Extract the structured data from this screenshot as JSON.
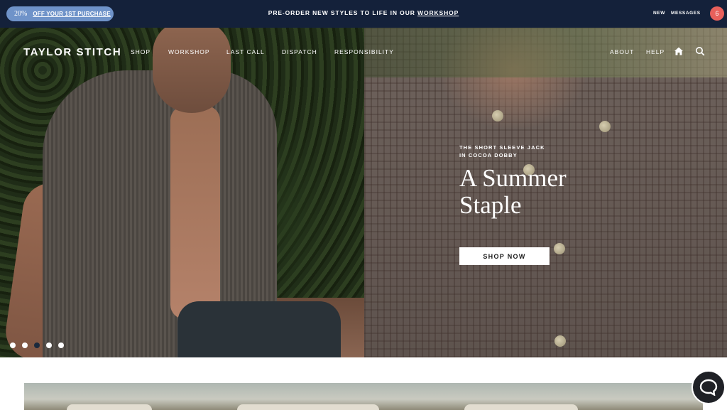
{
  "announcement": {
    "promo_percent": "20%",
    "promo_text": "OFF YOUR 1ST PURCHASE",
    "message_prefix": "PRE-ORDER NEW STYLES TO LIFE IN OUR ",
    "message_link": "WORKSHOP",
    "messages_new": "NEW",
    "messages_label": "MESSAGES",
    "messages_count": "6"
  },
  "header": {
    "logo": "TAYLOR STITCH",
    "nav": [
      "SHOP",
      "WORKSHOP",
      "LAST CALL",
      "DISPATCH",
      "RESPONSIBILITY"
    ],
    "utility": [
      "ABOUT",
      "HELP"
    ],
    "icons": [
      "home-icon",
      "search-icon"
    ]
  },
  "hero": {
    "eyebrow_line1": "THE SHORT SLEEVE JACK",
    "eyebrow_line2": "IN COCOA DOBBY",
    "headline_line1": "A Summer",
    "headline_line2": "Staple",
    "cta": "SHOP NOW",
    "slide_count": 5,
    "active_slide": 3
  },
  "colors": {
    "topbar": "#14213a",
    "promo_pill": "#6f93c9",
    "badge": "#e8605b"
  },
  "chat": {
    "icon": "chat-bubble-icon"
  }
}
